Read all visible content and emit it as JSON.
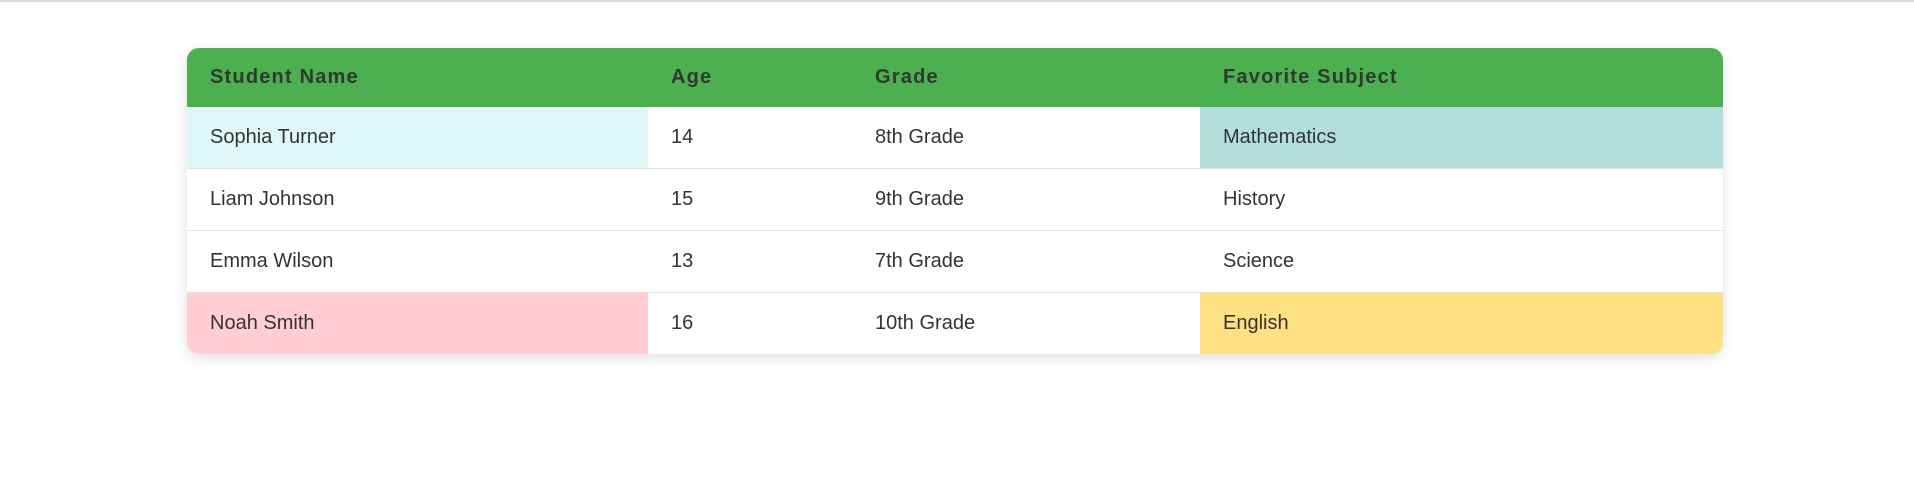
{
  "table": {
    "columns": [
      "Student Name",
      "Age",
      "Grade",
      "Favorite Subject"
    ],
    "rows": [
      {
        "name": "Sophia Turner",
        "age": "14",
        "grade": "8th Grade",
        "subject": "Mathematics",
        "name_bg": "#e0f7fa",
        "subject_bg": "#b2dfdb"
      },
      {
        "name": "Liam Johnson",
        "age": "15",
        "grade": "9th Grade",
        "subject": "History",
        "name_bg": "#ffffff",
        "subject_bg": "#ffffff"
      },
      {
        "name": "Emma Wilson",
        "age": "13",
        "grade": "7th Grade",
        "subject": "Science",
        "name_bg": "#ffffff",
        "subject_bg": "#ffffff"
      },
      {
        "name": "Noah Smith",
        "age": "16",
        "grade": "10th Grade",
        "subject": "English",
        "name_bg": "#ffcdd2",
        "subject_bg": "#ffe082"
      }
    ]
  },
  "colors": {
    "header_bg": "#4caf50",
    "row_divider": "#e2e2e2"
  }
}
